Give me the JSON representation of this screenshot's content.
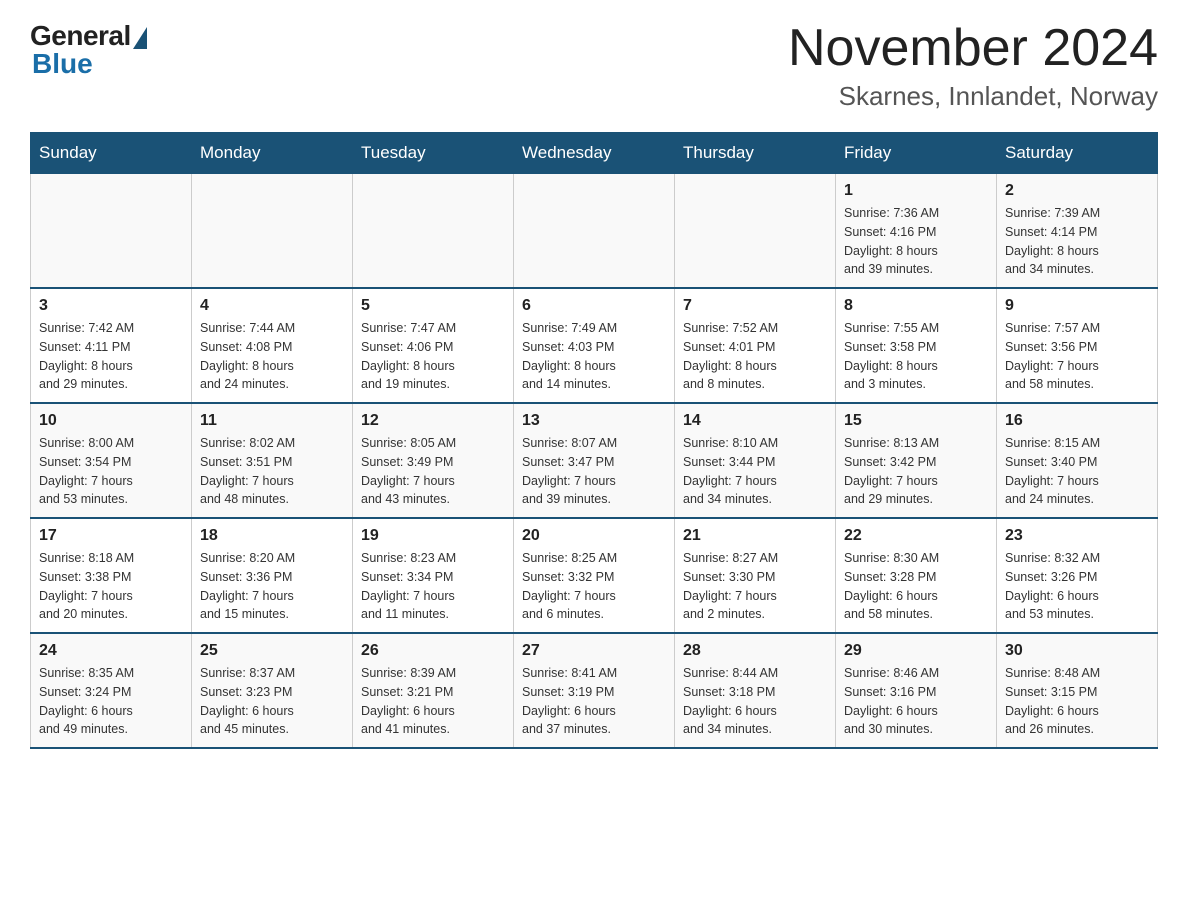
{
  "logo": {
    "general": "General",
    "blue": "Blue"
  },
  "header": {
    "month": "November 2024",
    "location": "Skarnes, Innlandet, Norway"
  },
  "days_of_week": [
    "Sunday",
    "Monday",
    "Tuesday",
    "Wednesday",
    "Thursday",
    "Friday",
    "Saturday"
  ],
  "weeks": [
    [
      {
        "day": "",
        "info": ""
      },
      {
        "day": "",
        "info": ""
      },
      {
        "day": "",
        "info": ""
      },
      {
        "day": "",
        "info": ""
      },
      {
        "day": "",
        "info": ""
      },
      {
        "day": "1",
        "info": "Sunrise: 7:36 AM\nSunset: 4:16 PM\nDaylight: 8 hours\nand 39 minutes."
      },
      {
        "day": "2",
        "info": "Sunrise: 7:39 AM\nSunset: 4:14 PM\nDaylight: 8 hours\nand 34 minutes."
      }
    ],
    [
      {
        "day": "3",
        "info": "Sunrise: 7:42 AM\nSunset: 4:11 PM\nDaylight: 8 hours\nand 29 minutes."
      },
      {
        "day": "4",
        "info": "Sunrise: 7:44 AM\nSunset: 4:08 PM\nDaylight: 8 hours\nand 24 minutes."
      },
      {
        "day": "5",
        "info": "Sunrise: 7:47 AM\nSunset: 4:06 PM\nDaylight: 8 hours\nand 19 minutes."
      },
      {
        "day": "6",
        "info": "Sunrise: 7:49 AM\nSunset: 4:03 PM\nDaylight: 8 hours\nand 14 minutes."
      },
      {
        "day": "7",
        "info": "Sunrise: 7:52 AM\nSunset: 4:01 PM\nDaylight: 8 hours\nand 8 minutes."
      },
      {
        "day": "8",
        "info": "Sunrise: 7:55 AM\nSunset: 3:58 PM\nDaylight: 8 hours\nand 3 minutes."
      },
      {
        "day": "9",
        "info": "Sunrise: 7:57 AM\nSunset: 3:56 PM\nDaylight: 7 hours\nand 58 minutes."
      }
    ],
    [
      {
        "day": "10",
        "info": "Sunrise: 8:00 AM\nSunset: 3:54 PM\nDaylight: 7 hours\nand 53 minutes."
      },
      {
        "day": "11",
        "info": "Sunrise: 8:02 AM\nSunset: 3:51 PM\nDaylight: 7 hours\nand 48 minutes."
      },
      {
        "day": "12",
        "info": "Sunrise: 8:05 AM\nSunset: 3:49 PM\nDaylight: 7 hours\nand 43 minutes."
      },
      {
        "day": "13",
        "info": "Sunrise: 8:07 AM\nSunset: 3:47 PM\nDaylight: 7 hours\nand 39 minutes."
      },
      {
        "day": "14",
        "info": "Sunrise: 8:10 AM\nSunset: 3:44 PM\nDaylight: 7 hours\nand 34 minutes."
      },
      {
        "day": "15",
        "info": "Sunrise: 8:13 AM\nSunset: 3:42 PM\nDaylight: 7 hours\nand 29 minutes."
      },
      {
        "day": "16",
        "info": "Sunrise: 8:15 AM\nSunset: 3:40 PM\nDaylight: 7 hours\nand 24 minutes."
      }
    ],
    [
      {
        "day": "17",
        "info": "Sunrise: 8:18 AM\nSunset: 3:38 PM\nDaylight: 7 hours\nand 20 minutes."
      },
      {
        "day": "18",
        "info": "Sunrise: 8:20 AM\nSunset: 3:36 PM\nDaylight: 7 hours\nand 15 minutes."
      },
      {
        "day": "19",
        "info": "Sunrise: 8:23 AM\nSunset: 3:34 PM\nDaylight: 7 hours\nand 11 minutes."
      },
      {
        "day": "20",
        "info": "Sunrise: 8:25 AM\nSunset: 3:32 PM\nDaylight: 7 hours\nand 6 minutes."
      },
      {
        "day": "21",
        "info": "Sunrise: 8:27 AM\nSunset: 3:30 PM\nDaylight: 7 hours\nand 2 minutes."
      },
      {
        "day": "22",
        "info": "Sunrise: 8:30 AM\nSunset: 3:28 PM\nDaylight: 6 hours\nand 58 minutes."
      },
      {
        "day": "23",
        "info": "Sunrise: 8:32 AM\nSunset: 3:26 PM\nDaylight: 6 hours\nand 53 minutes."
      }
    ],
    [
      {
        "day": "24",
        "info": "Sunrise: 8:35 AM\nSunset: 3:24 PM\nDaylight: 6 hours\nand 49 minutes."
      },
      {
        "day": "25",
        "info": "Sunrise: 8:37 AM\nSunset: 3:23 PM\nDaylight: 6 hours\nand 45 minutes."
      },
      {
        "day": "26",
        "info": "Sunrise: 8:39 AM\nSunset: 3:21 PM\nDaylight: 6 hours\nand 41 minutes."
      },
      {
        "day": "27",
        "info": "Sunrise: 8:41 AM\nSunset: 3:19 PM\nDaylight: 6 hours\nand 37 minutes."
      },
      {
        "day": "28",
        "info": "Sunrise: 8:44 AM\nSunset: 3:18 PM\nDaylight: 6 hours\nand 34 minutes."
      },
      {
        "day": "29",
        "info": "Sunrise: 8:46 AM\nSunset: 3:16 PM\nDaylight: 6 hours\nand 30 minutes."
      },
      {
        "day": "30",
        "info": "Sunrise: 8:48 AM\nSunset: 3:15 PM\nDaylight: 6 hours\nand 26 minutes."
      }
    ]
  ]
}
